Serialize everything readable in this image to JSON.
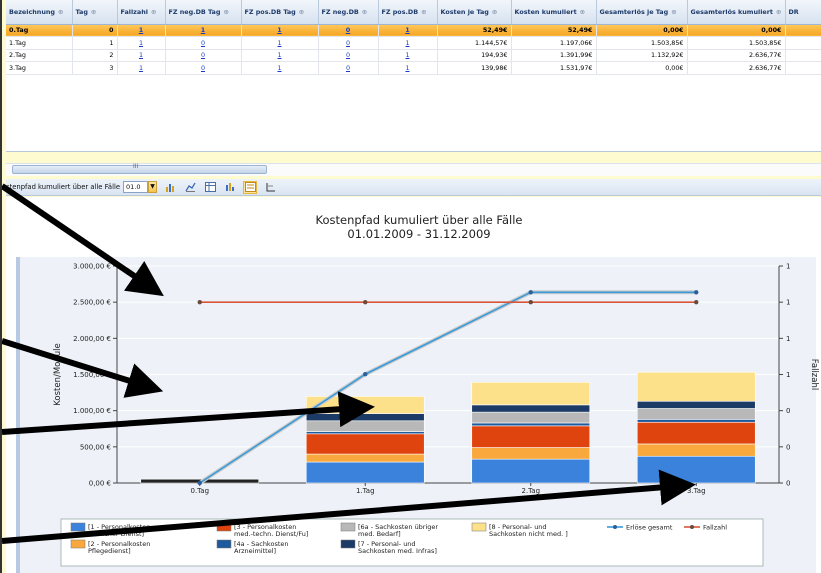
{
  "table": {
    "columns": [
      "Bezeichnung",
      "Tag",
      "Fallzahl",
      "FZ neg.DB Tag",
      "FZ pos.DB Tag",
      "FZ neg.DB",
      "FZ pos.DB",
      "Kosten je Tag",
      "Kosten kumuliert",
      "Gesamterlös je Tag",
      "Gesamterlös kumuliert",
      "DR"
    ],
    "rows": [
      [
        "0.Tag",
        "0",
        "1",
        "1",
        "1",
        "0",
        "1",
        "52,49€",
        "52,49€",
        "0,00€",
        "0,00€"
      ],
      [
        "1.Tag",
        "1",
        "1",
        "0",
        "1",
        "0",
        "1",
        "1.144,57€",
        "1.197,06€",
        "1.503,85€",
        "1.503,85€"
      ],
      [
        "2.Tag",
        "2",
        "1",
        "0",
        "1",
        "0",
        "1",
        "194,93€",
        "1.391,99€",
        "1.132,92€",
        "2.636,77€"
      ],
      [
        "3.Tag",
        "3",
        "1",
        "0",
        "1",
        "0",
        "1",
        "139,98€",
        "1.531,97€",
        "0,00€",
        "2.636,77€"
      ]
    ],
    "filter_glyph": "⊕",
    "scroll_glyph": "III"
  },
  "toolbar": {
    "label": "stenpfad kumuliert über alle Fälle",
    "zoom_value": "01.0",
    "dropdown_glyph": "▼"
  },
  "chart_data": {
    "type": "bar",
    "title": "Kostenpfad kumuliert über alle Fälle",
    "subtitle": "01.01.2009 - 31.12.2009",
    "ylabel": "Kosten/Module",
    "y2label": "Fallzahl",
    "categories": [
      "0.Tag",
      "1.Tag",
      "2.Tag",
      "3.Tag"
    ],
    "ylim": [
      0,
      3000
    ],
    "yticks": [
      "0,00 €",
      "500,00 €",
      "1.000,00 €",
      "1.500,00 €",
      "2.000,00 €",
      "2.500,00 €",
      "3.000,00 €"
    ],
    "y2ticks": [
      "0",
      "0",
      "0",
      "1",
      "1",
      "1",
      "1"
    ],
    "stacked": true,
    "series": [
      {
        "name": "[1 - Personalkosten ärztlicher Dienst]",
        "color": "#3b82dc",
        "values": [
          0,
          290,
          330,
          370
        ]
      },
      {
        "name": "[2 - Personalkosten Pflegedienst]",
        "color": "#f8a83c",
        "values": [
          0,
          110,
          160,
          170
        ]
      },
      {
        "name": "[3 - Personalkosten med.-techn. Dienst/Fu]",
        "color": "#e0440e",
        "values": [
          0,
          280,
          300,
          300
        ]
      },
      {
        "name": "[4a - Sachkosten Arzneimittel]",
        "color": "#1f5a9e",
        "values": [
          0,
          30,
          40,
          40
        ]
      },
      {
        "name": "[6a - Sachkosten übriger med. Bedarf]",
        "color": "#b8b8b8",
        "values": [
          0,
          150,
          150,
          150
        ]
      },
      {
        "name": "[7 - Personal- und Sachkosten med. Infras]",
        "color": "#1c3a66",
        "values": [
          0,
          100,
          100,
          100
        ]
      },
      {
        "name": "[8 - Personal- und Sachkosten nicht med. ]",
        "color": "#fde08a",
        "values": [
          52.49,
          237,
          312,
          402
        ]
      }
    ],
    "lines": [
      {
        "name": "Erlöse gesamt",
        "color": "#3a9ad9",
        "values": [
          0,
          1503.85,
          2636.77,
          2636.77
        ]
      },
      {
        "name": "Fallzahl",
        "color": "#d9553a",
        "values": [
          2500,
          2500,
          2500,
          2500
        ]
      }
    ]
  }
}
